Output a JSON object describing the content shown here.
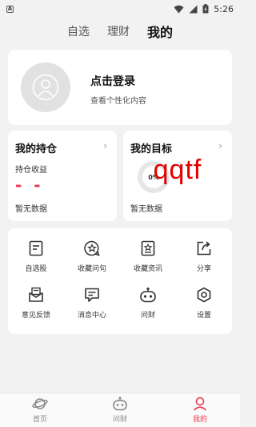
{
  "status_bar": {
    "notification_letter": "A",
    "time": "5:26"
  },
  "top_tabs": [
    {
      "label": "自选",
      "active": false
    },
    {
      "label": "理财",
      "active": false
    },
    {
      "label": "我的",
      "active": true
    }
  ],
  "profile": {
    "title": "点击登录",
    "subtitle": "查看个性化内容"
  },
  "holdings_card": {
    "title": "我的持仓",
    "chevron": "›",
    "label": "持仓收益",
    "value": "- -",
    "empty": "暂无数据"
  },
  "goal_card": {
    "title": "我的目标",
    "chevron": "›",
    "ring_text": "0%",
    "empty": "暂无数据",
    "watermark": "qqtf"
  },
  "menu": [
    {
      "label": "自选股",
      "icon": "watchlist-icon"
    },
    {
      "label": "收藏问句",
      "icon": "star-bubble-icon"
    },
    {
      "label": "收藏资讯",
      "icon": "star-document-icon"
    },
    {
      "label": "分享",
      "icon": "share-icon"
    },
    {
      "label": "意见反馈",
      "icon": "feedback-mail-icon"
    },
    {
      "label": "消息中心",
      "icon": "message-icon"
    },
    {
      "label": "问财",
      "icon": "robot-icon"
    },
    {
      "label": "设置",
      "icon": "settings-hexagon-icon"
    }
  ],
  "bottom_nav": [
    {
      "label": "首页",
      "icon": "planet-icon",
      "active": false
    },
    {
      "label": "问财",
      "icon": "robot-icon",
      "active": false
    },
    {
      "label": "我的",
      "icon": "person-icon",
      "active": true
    }
  ],
  "colors": {
    "accent": "#e8384f",
    "background": "#f2f2f2",
    "card": "#ffffff"
  }
}
